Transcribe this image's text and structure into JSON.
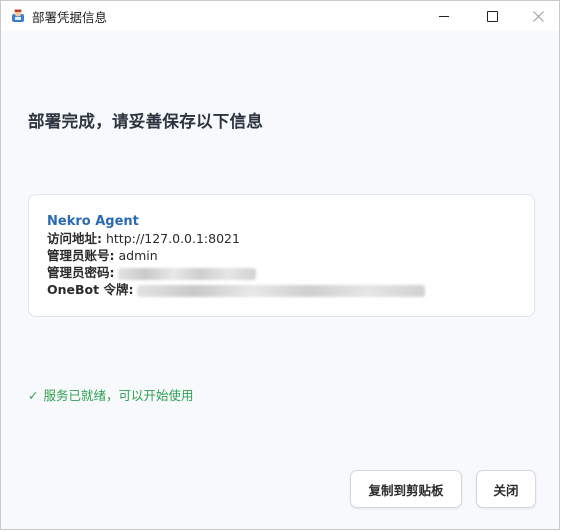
{
  "window": {
    "title": "部署凭据信息",
    "app_icon": "app-logo-icon",
    "controls": {
      "minimize": "minimize-icon",
      "maximize": "maximize-icon",
      "close": "close-icon"
    }
  },
  "main": {
    "heading": "部署完成，请妥善保存以下信息"
  },
  "credentials": {
    "agent_name": "Nekro Agent",
    "url_label": "访问地址:",
    "url_value": "http://127.0.0.1:8021",
    "admin_label": "管理员账号:",
    "admin_value": "admin",
    "password_label": "管理员密码:",
    "token_label": "OneBot 令牌:"
  },
  "status": {
    "icon": "checkmark-icon",
    "check": "✓",
    "text": "服务已就绪，可以开始使用",
    "color": "#2fa14f"
  },
  "buttons": {
    "copy": "复制到剪贴板",
    "close": "关闭"
  },
  "colors": {
    "agent_name": "#2a6ab3",
    "heading": "#2c3440",
    "window_bg": "#f7f9fc"
  }
}
